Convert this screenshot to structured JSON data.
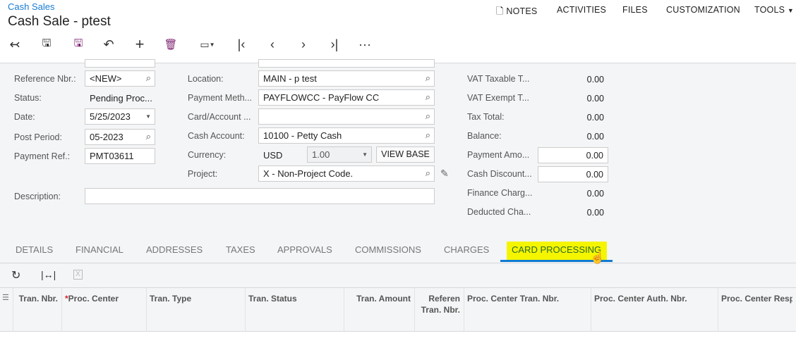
{
  "header": {
    "breadcrumb": "Cash Sales",
    "title": "Cash Sale - ptest",
    "menu": [
      "NOTES",
      "ACTIVITIES",
      "FILES",
      "CUSTOMIZATION",
      "TOOLS"
    ]
  },
  "toolbar": [
    "back-icon",
    "save-close-icon",
    "save-icon",
    "undo-icon",
    "add-icon",
    "delete-icon",
    "copy-paste-icon",
    "first-icon",
    "prev-icon",
    "next-icon",
    "last-icon",
    "more-icon"
  ],
  "form": {
    "reference_label": "Reference Nbr.:",
    "reference": "<NEW>",
    "status_label": "Status:",
    "status": "Pending Proc...",
    "date_label": "Date:",
    "date": "5/25/2023",
    "period_label": "Post Period:",
    "period": "05-2023",
    "payref_label": "Payment Ref.:",
    "payref": "PMT03611",
    "description_label": "Description:",
    "description": "",
    "location_label": "Location:",
    "location": "MAIN - p test",
    "paymethod_label": "Payment Meth...",
    "paymethod": "PAYFLOWCC - PayFlow CC",
    "card_label": "Card/Account ...",
    "card": "",
    "cashacct_label": "Cash Account:",
    "cashacct": "10100 - Petty Cash",
    "currency_label": "Currency:",
    "currency": "USD",
    "rate": "1.00",
    "viewbase": "VIEW BASE",
    "project_label": "Project:",
    "project": "X - Non-Project Code."
  },
  "totals": [
    {
      "label": "VAT Taxable T...",
      "value": "0.00"
    },
    {
      "label": "VAT Exempt T...",
      "value": "0.00"
    },
    {
      "label": "Tax Total:",
      "value": "0.00"
    },
    {
      "label": "Balance:",
      "value": "0.00"
    },
    {
      "label": "Payment Amo...",
      "value": "0.00"
    },
    {
      "label": "Cash Discount...",
      "value": "0.00"
    },
    {
      "label": "Finance Charg...",
      "value": "0.00"
    },
    {
      "label": "Deducted Cha...",
      "value": "0.00"
    }
  ],
  "tabs": [
    "DETAILS",
    "FINANCIAL",
    "ADDRESSES",
    "TAXES",
    "APPROVALS",
    "COMMISSIONS",
    "CHARGES",
    "CARD PROCESSING"
  ],
  "active_tab": "CARD PROCESSING",
  "colors": {
    "accent": "#0f7bd1",
    "highlight": "#f5f500"
  },
  "grid": {
    "columns": [
      "Tran. Nbr.",
      "Proc. Center",
      "Tran. Type",
      "Tran. Status",
      "Tran. Amount",
      "Referen Tran. Nbr.",
      "Proc. Center Tran. Nbr.",
      "Proc. Center Auth. Nbr.",
      "Proc. Center Respo"
    ]
  }
}
